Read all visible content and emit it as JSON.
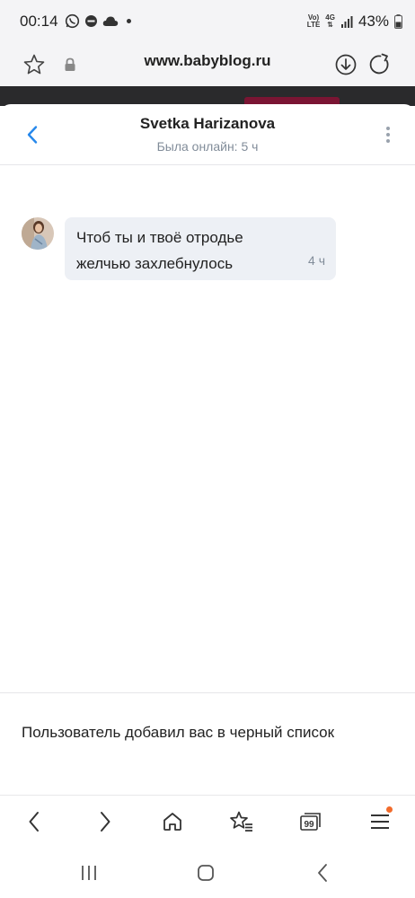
{
  "status_bar": {
    "time": "00:14",
    "network_top": "Vo)",
    "network_bottom": "LTE",
    "gen_top": "4G",
    "battery": "43%"
  },
  "browser": {
    "url": "www.babyblog.ru"
  },
  "chat": {
    "title": "Svetka Harizanova",
    "subtitle": "Была онлайн: 5 ч",
    "messages": [
      {
        "text": "Чтоб ты и твоё отродье желчью захлебнулось",
        "time": "4 ч"
      }
    ],
    "blocked_notice": "Пользователь добавил вас в черный список"
  },
  "toolbar": {
    "tabs_count": "99"
  },
  "colors": {
    "accent": "#2688eb",
    "bubble_bg": "#edf0f5",
    "secondary_text": "#818c99",
    "badge": "#f26b2b"
  },
  "icons": [
    "star-icon",
    "lock-icon",
    "download-icon",
    "reload-icon",
    "back-arrow-icon",
    "more-vertical-icon",
    "home-icon",
    "bookmarks-icon",
    "tabs-icon",
    "menu-icon"
  ]
}
